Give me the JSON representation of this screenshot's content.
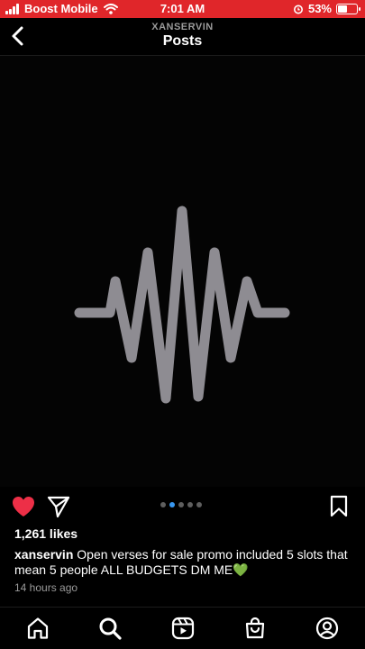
{
  "status_bar": {
    "carrier": "Boost Mobile",
    "time": "7:01 AM",
    "battery_text": "53%",
    "battery_level": 0.53,
    "background_color": "#e0262a"
  },
  "header": {
    "username": "XANSERVIN",
    "title": "Posts",
    "back_icon": "chevron-left-icon"
  },
  "post": {
    "media_icon": "audio-waveform",
    "waveform_color": "#8e8c92",
    "carousel": {
      "count": 5,
      "active_index": 1,
      "active_color": "#3897f0"
    },
    "liked": true,
    "like_color": "#ed2f47",
    "likes_text": "1,261 likes",
    "caption_user": "xanservin",
    "caption_text": " Open verses for sale promo included 5 slots that mean 5 people ALL BUDGETS DM ME💚",
    "timestamp": "14 hours ago"
  },
  "bottom_nav": {
    "items": [
      "home-icon",
      "search-icon",
      "reels-icon",
      "shop-icon",
      "profile-icon"
    ],
    "active": "search-icon"
  }
}
